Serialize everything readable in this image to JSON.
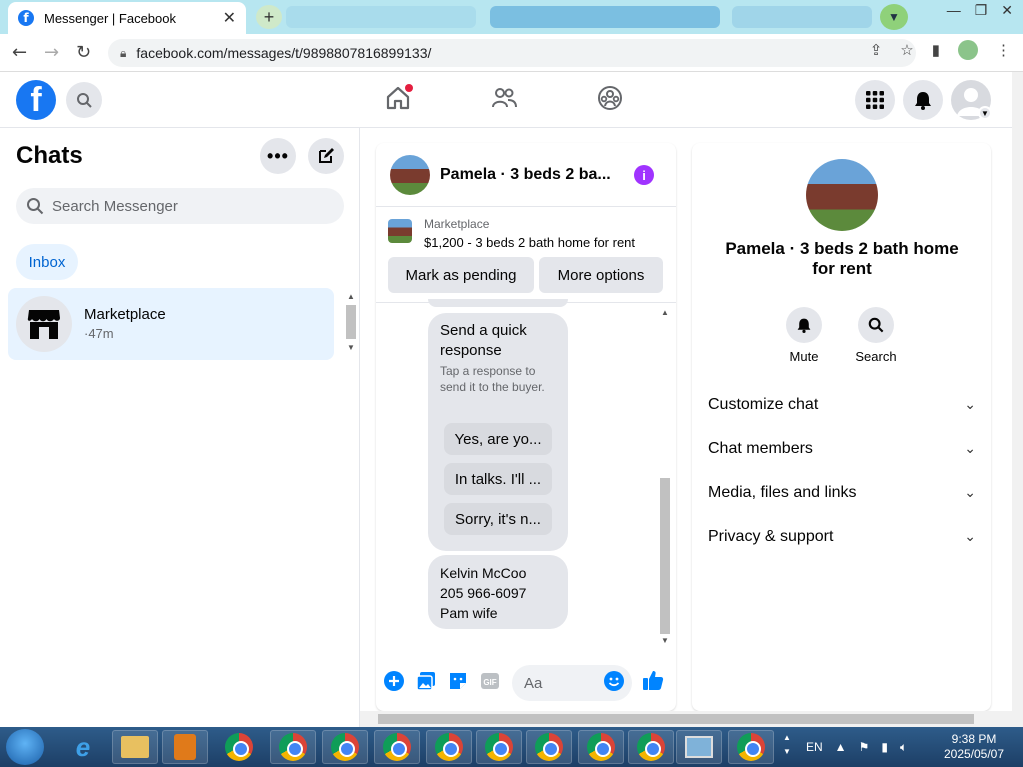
{
  "browser": {
    "tab_title": "Messenger | Facebook",
    "tab_favicon": "f",
    "url": "facebook.com/messages/t/9898807816899133/"
  },
  "left": {
    "title": "Chats",
    "search_placeholder": "Search Messenger",
    "inbox_label": "Inbox",
    "chat": {
      "name": "Marketplace",
      "time": "·47m"
    }
  },
  "conversation": {
    "title": "Pamela · 3 beds 2 ba...",
    "banner_source": "Marketplace",
    "banner_listing": "$1,200 - 3 beds 2 bath home for rent",
    "mark_pending": "Mark as pending",
    "more_options": "More options",
    "quick_title": "Send a quick response",
    "quick_sub": "Tap a response to send it to the buyer.",
    "quick_replies": [
      "Yes, are yo...",
      "In talks. I'll ...",
      "Sorry, it's n..."
    ],
    "message_lines": [
      "Kelvin McCoo",
      "205 966-6097",
      "Pam wife"
    ],
    "composer_placeholder": "Aa"
  },
  "right": {
    "name": "Pamela · 3 beds 2 bath home for rent",
    "mute": "Mute",
    "search": "Search",
    "items": [
      "Customize chat",
      "Chat members",
      "Media, files and links",
      "Privacy & support"
    ]
  },
  "taskbar": {
    "lang": "EN",
    "time": "9:38 PM",
    "date": "2025/05/07"
  },
  "colors": {
    "fb_blue": "#1877f2",
    "accent_purple": "#a033ff",
    "selected_bg": "#e7f3ff"
  }
}
